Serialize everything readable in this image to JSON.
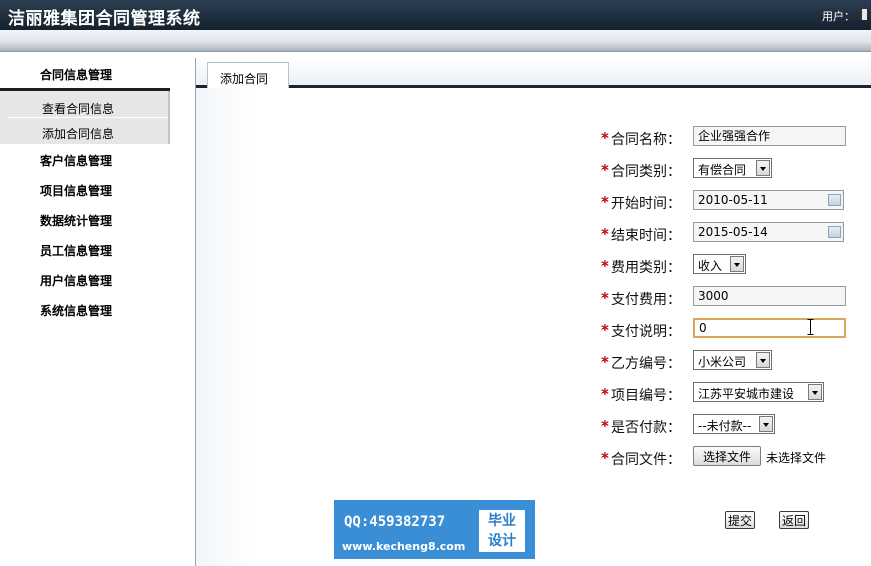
{
  "header": {
    "title": "洁丽雅集团合同管理系统",
    "user_label": "用户："
  },
  "sidebar": {
    "sections": [
      {
        "label": "合同信息管理",
        "sub_items": [
          {
            "label": "查看合同信息"
          },
          {
            "label": "添加合同信息"
          }
        ]
      },
      {
        "label": "客户信息管理"
      },
      {
        "label": "项目信息管理"
      },
      {
        "label": "数据统计管理"
      },
      {
        "label": "员工信息管理"
      },
      {
        "label": "用户信息管理"
      },
      {
        "label": "系统信息管理"
      }
    ]
  },
  "tab": {
    "label": "添加合同"
  },
  "form": {
    "required_mark": "*",
    "contract_name": {
      "label": "合同名称：",
      "value": "企业强强合作"
    },
    "contract_type": {
      "label": "合同类别：",
      "value": "有偿合同"
    },
    "start_time": {
      "label": "开始时间：",
      "value": "2010-05-11"
    },
    "end_time": {
      "label": "结束时间：",
      "value": "2015-05-14"
    },
    "fee_type": {
      "label": "费用类别：",
      "value": "收入"
    },
    "payment": {
      "label": "支付费用：",
      "value": "3000"
    },
    "payment_note": {
      "label": "支付说明：",
      "value": "0"
    },
    "party_b": {
      "label": "乙方编号：",
      "value": "小米公司"
    },
    "project": {
      "label": "项目编号：",
      "value": "江苏平安城市建设"
    },
    "is_paid": {
      "label": "是否付款：",
      "value": "--未付款--"
    },
    "contract_file": {
      "label": "合同文件：",
      "button": "选择文件",
      "status": "未选择文件"
    }
  },
  "actions": {
    "submit": "提交",
    "back": "返回"
  },
  "watermark": {
    "qq": "QQ:459382737",
    "site": "www.kecheng8.com",
    "tag_line1": "毕业",
    "tag_line2": "设计"
  }
}
